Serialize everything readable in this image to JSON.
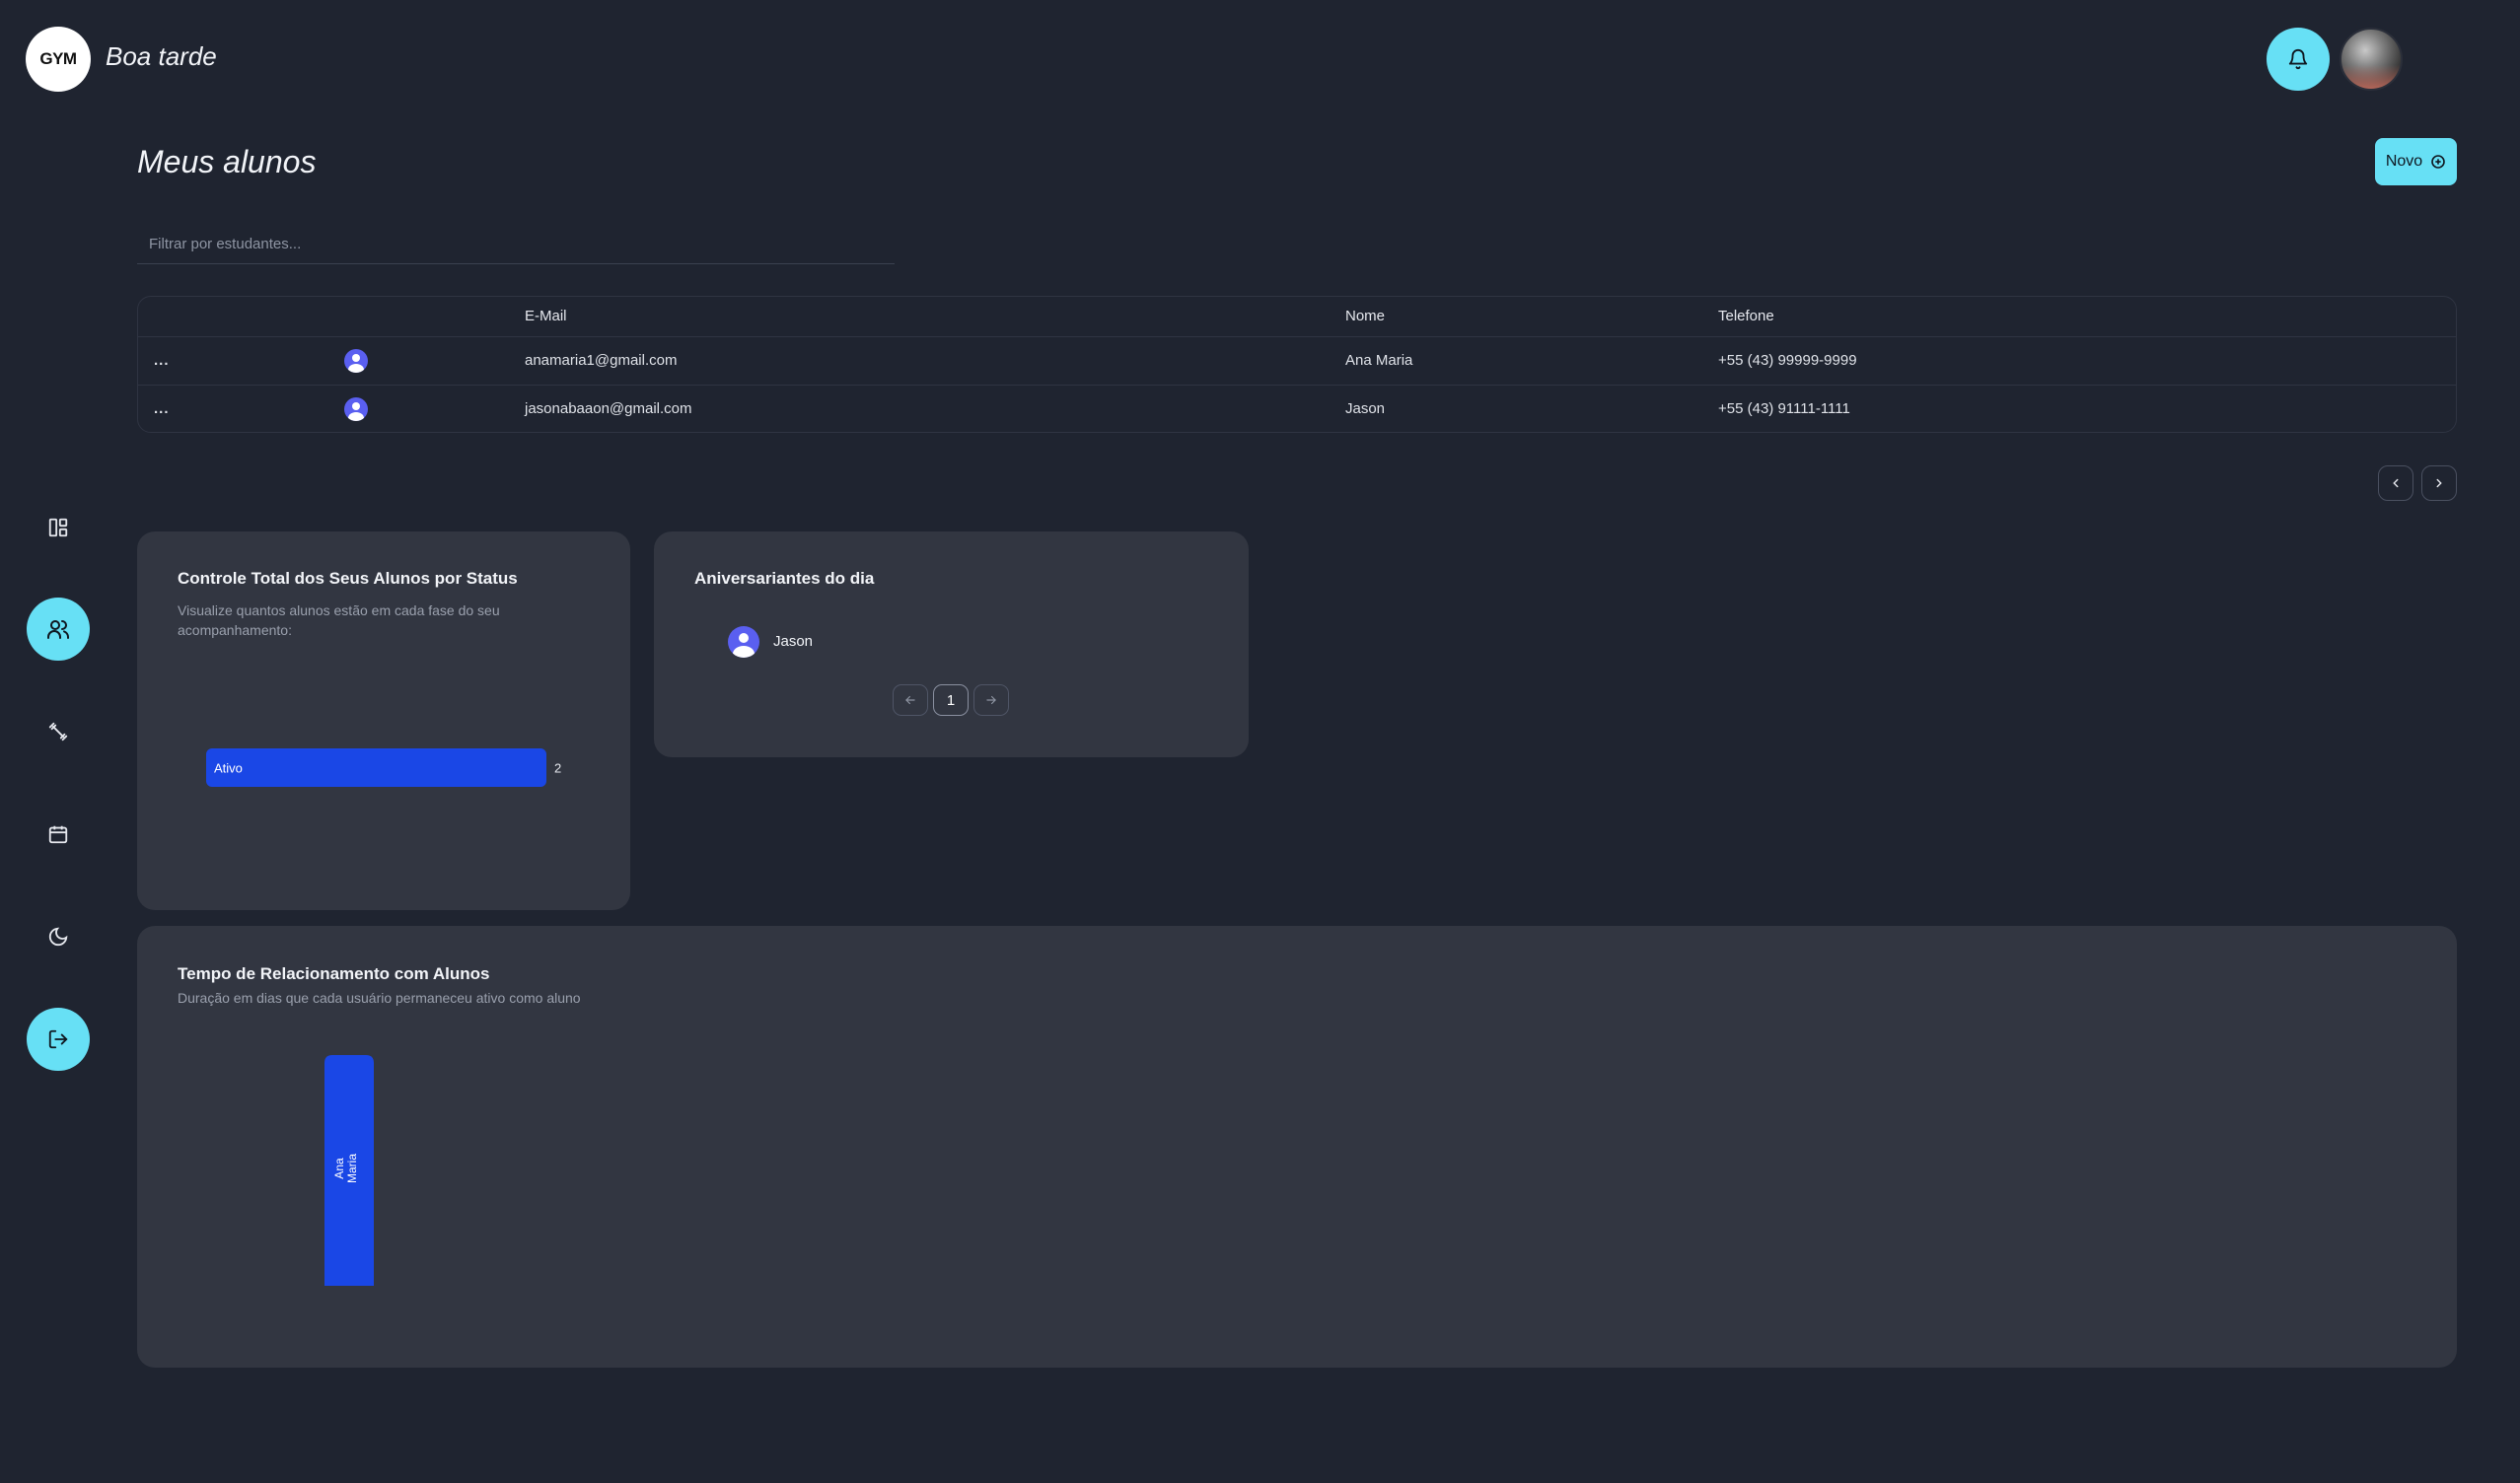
{
  "header": {
    "logo_text": "GYM",
    "greeting": "Boa tarde"
  },
  "sidebar": {
    "items": [
      {
        "icon": "dashboard-icon",
        "active": false
      },
      {
        "icon": "users-icon",
        "active": true
      },
      {
        "icon": "dumbbell-icon",
        "active": false
      },
      {
        "icon": "calendar-icon",
        "active": false
      },
      {
        "icon": "moon-icon",
        "active": false
      },
      {
        "icon": "logout-icon",
        "active": true
      }
    ]
  },
  "main": {
    "title": "Meus alunos",
    "new_button_label": "Novo",
    "search": {
      "placeholder": "Filtrar por estudantes...",
      "value": ""
    },
    "table": {
      "columns": [
        "",
        "",
        "E-Mail",
        "Nome",
        "Telefone"
      ],
      "rows": [
        {
          "menu": "...",
          "email": "anamaria1@gmail.com",
          "name": "Ana Maria",
          "phone": "+55 (43) 99999-9999"
        },
        {
          "menu": "...",
          "email": "jasonabaaon@gmail.com",
          "name": "Jason",
          "phone": "+55 (43) 91111-1111"
        }
      ]
    }
  },
  "status_card": {
    "title": "Controle Total dos Seus Alunos por Status",
    "subtitle_line1": "Visualize quantos alunos estão em cada fase do seu",
    "subtitle_line2": "acompanhamento:"
  },
  "birthday_card": {
    "title": "Aniversariantes do dia",
    "people": [
      "Jason"
    ],
    "current_page": "1"
  },
  "relationship_card": {
    "title": "Tempo de Relacionamento com Alunos",
    "subtitle": "Duração em dias que cada usuário permaneceu ativo como aluno"
  },
  "colors": {
    "background": "#1f2430",
    "card": "#323641",
    "accent": "#67e0f5",
    "bar": "#1a47e6"
  },
  "chart_data": [
    {
      "type": "bar",
      "orientation": "horizontal",
      "categories": [
        "Ativo"
      ],
      "values": [
        2
      ],
      "xlim": [
        0,
        2
      ]
    },
    {
      "type": "bar",
      "orientation": "vertical",
      "categories": [
        "Ana Maria"
      ],
      "values": [
        1
      ],
      "ylim": [
        0,
        1
      ]
    }
  ]
}
